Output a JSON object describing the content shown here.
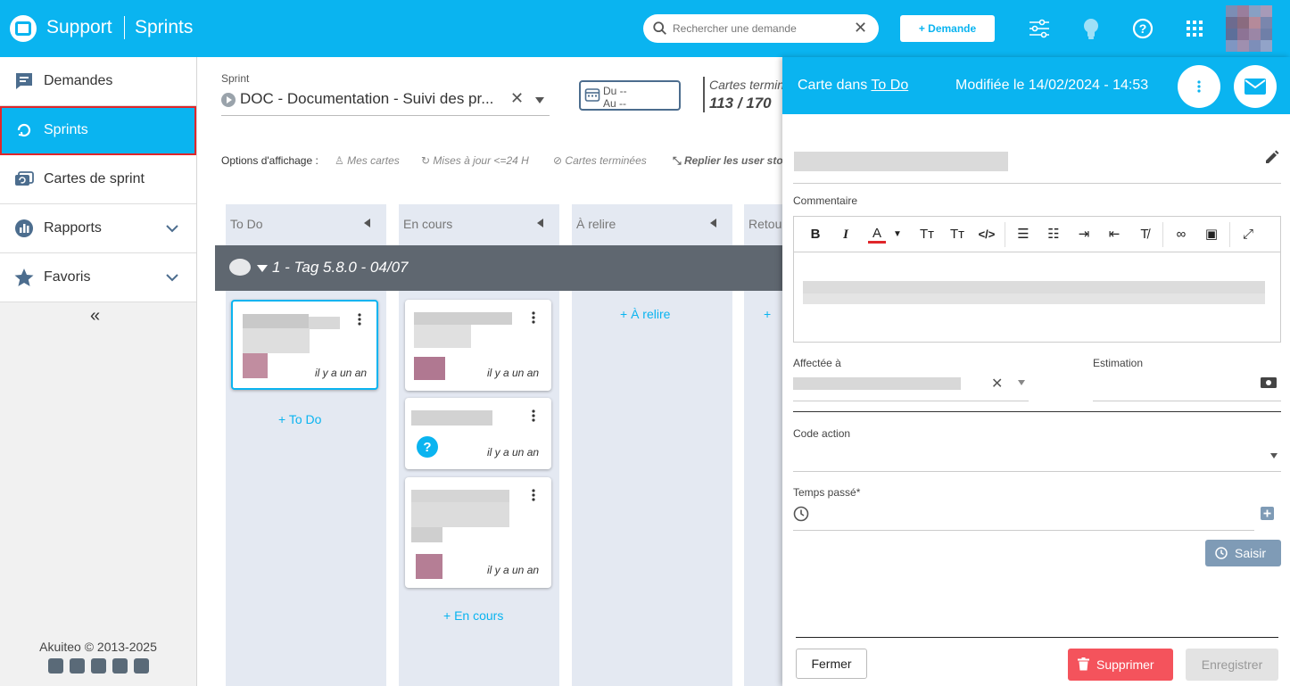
{
  "app": {
    "name": "Support",
    "section": "Sprints"
  },
  "search": {
    "placeholder": "Rechercher une demande"
  },
  "header": {
    "add_request_label": "+ Demande"
  },
  "sidebar": {
    "items": [
      {
        "label": "Demandes",
        "icon": "chat-square-icon"
      },
      {
        "label": "Sprints",
        "icon": "sync-icon"
      },
      {
        "label": "Cartes de sprint",
        "icon": "cards-icon"
      },
      {
        "label": "Rapports",
        "icon": "chart-icon"
      },
      {
        "label": "Favoris",
        "icon": "star-icon"
      }
    ],
    "collapse": "«",
    "copyright": "Akuiteo © 2013-2025"
  },
  "sprint": {
    "label": "Sprint",
    "value": "DOC - Documentation - Suivi des pr...",
    "date_from": "Du --",
    "date_to": "Au --",
    "done_label": "Cartes terminées",
    "done_count": "113 / 170"
  },
  "options": {
    "label": "Options d'affichage :",
    "my_cards": "Mes cartes",
    "updated": "Mises à jour <=24 H",
    "finished": "Cartes terminées",
    "fold": "Replier les user stories"
  },
  "columns": [
    {
      "title": "To Do",
      "add": "To Do"
    },
    {
      "title": "En cours",
      "add": "En cours"
    },
    {
      "title": "À relire",
      "add": "À relire"
    },
    {
      "title": "Retour"
    }
  ],
  "tag": {
    "title": "1 - Tag 5.8.0 - 04/07"
  },
  "cards": {
    "time": "il y a un an"
  },
  "panel": {
    "title_prefix": "Carte dans",
    "title_link": "To Do",
    "modified": "Modifiée le 14/02/2024 - 14:53",
    "comment_label": "Commentaire",
    "assigned_label": "Affectée à",
    "estimation_label": "Estimation",
    "code_label": "Code action",
    "time_label": "Temps passé*",
    "saisir": "Saisir",
    "close": "Fermer",
    "delete": "Supprimer",
    "save": "Enregistrer"
  },
  "colors": {
    "primary": "#0ab4f0",
    "danger": "#f4535c",
    "active_outline": "#e0262a",
    "column_bg": "#e4e9f2",
    "tag_bar": "#5f6770"
  }
}
